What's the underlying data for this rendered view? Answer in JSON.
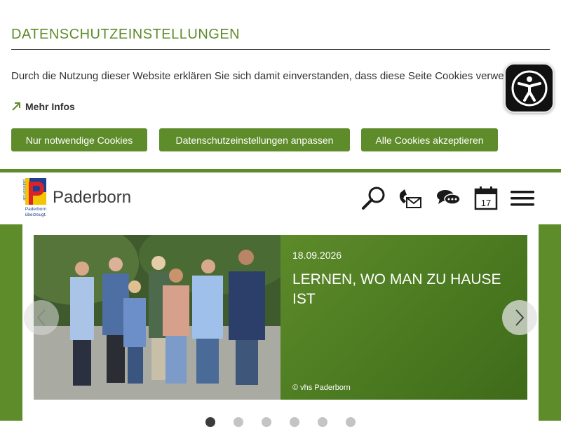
{
  "cookie_banner": {
    "title": "DATENSCHUTZEINSTELLUNGEN",
    "text": "Durch die Nutzung dieser Website erklären Sie sich damit einverstanden, dass diese Seite Cookies verwendet.",
    "more_info": "Mehr Infos",
    "buttons": {
      "necessary": "Nur notwendige Cookies",
      "customize": "Datenschutzeinstellungen anpassen",
      "accept_all": "Alle Cookies akzeptieren"
    }
  },
  "accessibility_icon": "accessibility-person-icon",
  "header": {
    "logo_lines": [
      "Paderborn",
      "überzeugt."
    ],
    "logo_side_text": "paderborn.de",
    "site_name": "Paderborn",
    "icons": [
      "search-icon",
      "phone-mail-icon",
      "chat-icon",
      "calendar-icon",
      "menu-icon"
    ],
    "calendar_day": "17"
  },
  "slider": {
    "date": "18.09.2026",
    "title": "LERNEN, WO MAN ZU HAUSE IST",
    "credit": "© vhs Paderborn",
    "dot_count": 6,
    "active_dot": 1
  },
  "colors": {
    "brand_green": "#5e8c2a",
    "dark": "#3b3b3b",
    "accessibility_bg": "#111111"
  }
}
